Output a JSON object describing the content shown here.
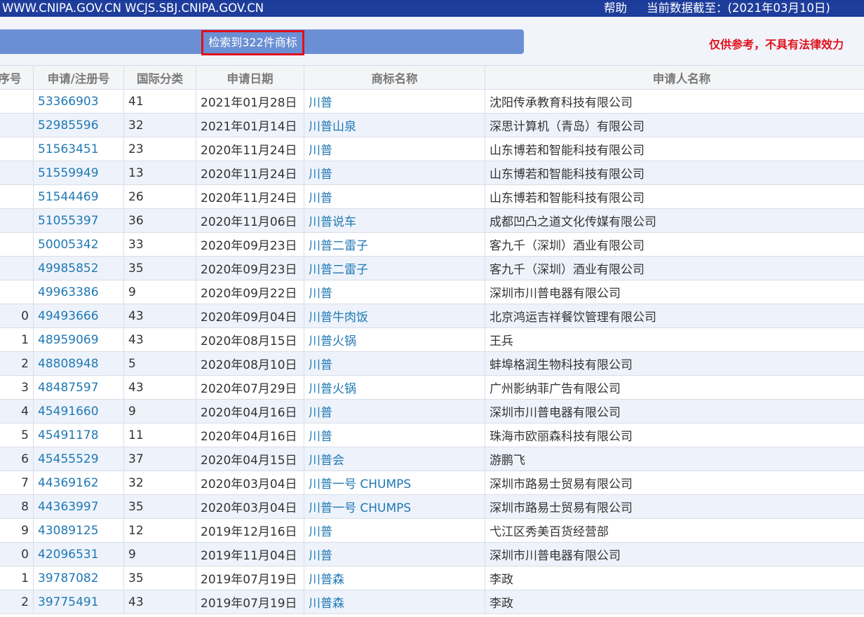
{
  "topbar": {
    "domains": "WWW.CNIPA.GOV.CN  WCJS.SBJ.CNIPA.GOV.CN",
    "help": "帮助",
    "date_info": "当前数据截至：(2021年03月10日)"
  },
  "search": {
    "count_text": "检索到322件商标",
    "disclaimer": "仅供参考，不具有法律效力"
  },
  "table": {
    "headers": [
      "序号",
      "申请/注册号",
      "国际分类",
      "申请日期",
      "商标名称",
      "申请人名称"
    ],
    "rows": [
      {
        "seq": "",
        "reg_no": "53366903",
        "class": "41",
        "date": "2021年01月28日",
        "name": "川普",
        "applicant": "沈阳传承教育科技有限公司"
      },
      {
        "seq": "",
        "reg_no": "52985596",
        "class": "32",
        "date": "2021年01月14日",
        "name": "川普山泉",
        "applicant": "深思计算机（青岛）有限公司"
      },
      {
        "seq": "",
        "reg_no": "51563451",
        "class": "23",
        "date": "2020年11月24日",
        "name": "川普",
        "applicant": "山东博若和智能科技有限公司"
      },
      {
        "seq": "",
        "reg_no": "51559949",
        "class": "13",
        "date": "2020年11月24日",
        "name": "川普",
        "applicant": "山东博若和智能科技有限公司"
      },
      {
        "seq": "",
        "reg_no": "51544469",
        "class": "26",
        "date": "2020年11月24日",
        "name": "川普",
        "applicant": "山东博若和智能科技有限公司"
      },
      {
        "seq": "",
        "reg_no": "51055397",
        "class": "36",
        "date": "2020年11月06日",
        "name": "川普说车",
        "applicant": "成都凹凸之道文化传媒有限公司"
      },
      {
        "seq": "",
        "reg_no": "50005342",
        "class": "33",
        "date": "2020年09月23日",
        "name": "川普二雷子",
        "applicant": "客九千（深圳）酒业有限公司"
      },
      {
        "seq": "",
        "reg_no": "49985852",
        "class": "35",
        "date": "2020年09月23日",
        "name": "川普二雷子",
        "applicant": "客九千（深圳）酒业有限公司"
      },
      {
        "seq": "",
        "reg_no": "49963386",
        "class": "9",
        "date": "2020年09月22日",
        "name": "川普",
        "applicant": "深圳市川普电器有限公司"
      },
      {
        "seq": "0",
        "reg_no": "49493666",
        "class": "43",
        "date": "2020年09月04日",
        "name": "川普牛肉饭",
        "applicant": "北京鸿运吉祥餐饮管理有限公司"
      },
      {
        "seq": "1",
        "reg_no": "48959069",
        "class": "43",
        "date": "2020年08月15日",
        "name": "川普火锅",
        "applicant": "王兵"
      },
      {
        "seq": "2",
        "reg_no": "48808948",
        "class": "5",
        "date": "2020年08月10日",
        "name": "川普",
        "applicant": "蚌埠格润生物科技有限公司"
      },
      {
        "seq": "3",
        "reg_no": "48487597",
        "class": "43",
        "date": "2020年07月29日",
        "name": "川普火锅",
        "applicant": "广州影纳菲广告有限公司"
      },
      {
        "seq": "4",
        "reg_no": "45491660",
        "class": "9",
        "date": "2020年04月16日",
        "name": "川普",
        "applicant": "深圳市川普电器有限公司"
      },
      {
        "seq": "5",
        "reg_no": "45491178",
        "class": "11",
        "date": "2020年04月16日",
        "name": "川普",
        "applicant": "珠海市欧丽森科技有限公司"
      },
      {
        "seq": "6",
        "reg_no": "45455529",
        "class": "37",
        "date": "2020年04月15日",
        "name": "川普会",
        "applicant": "游鹏飞"
      },
      {
        "seq": "7",
        "reg_no": "44369162",
        "class": "32",
        "date": "2020年03月04日",
        "name": "川普一号 CHUMPS",
        "applicant": "深圳市路易士贸易有限公司"
      },
      {
        "seq": "8",
        "reg_no": "44363997",
        "class": "35",
        "date": "2020年03月04日",
        "name": "川普一号 CHUMPS",
        "applicant": "深圳市路易士贸易有限公司"
      },
      {
        "seq": "9",
        "reg_no": "43089125",
        "class": "12",
        "date": "2019年12月16日",
        "name": "川普",
        "applicant": "弋江区秀美百货经营部"
      },
      {
        "seq": "0",
        "reg_no": "42096531",
        "class": "9",
        "date": "2019年11月04日",
        "name": "川普",
        "applicant": "深圳市川普电器有限公司"
      },
      {
        "seq": "1",
        "reg_no": "39787082",
        "class": "35",
        "date": "2019年07月19日",
        "name": "川普森",
        "applicant": "李政"
      },
      {
        "seq": "2",
        "reg_no": "39775491",
        "class": "43",
        "date": "2019年07月19日",
        "name": "川普森",
        "applicant": "李政"
      }
    ]
  }
}
